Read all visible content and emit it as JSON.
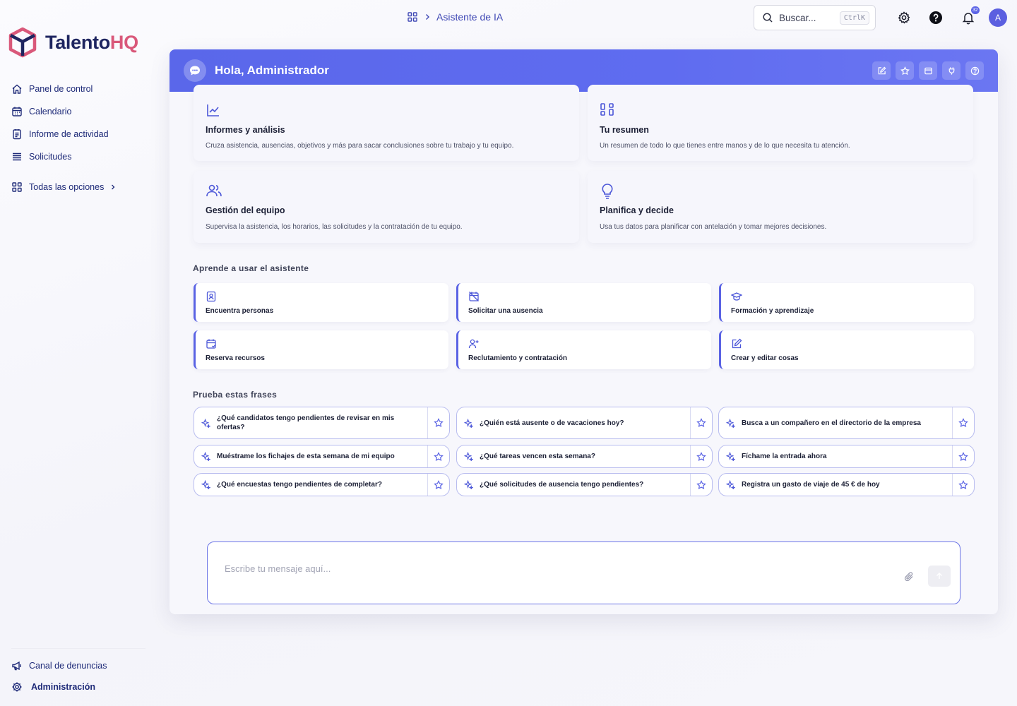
{
  "brand": {
    "name_main": "Talento",
    "name_accent": "HQ"
  },
  "sidebar": {
    "items": [
      {
        "label": "Panel de control",
        "icon": "home-icon"
      },
      {
        "label": "Calendario",
        "icon": "calendar-icon"
      },
      {
        "label": "Informe de actividad",
        "icon": "report-icon"
      },
      {
        "label": "Solicitudes",
        "icon": "list-icon"
      }
    ],
    "all_options": "Todas las opciones",
    "bottom": [
      {
        "label": "Canal de denuncias",
        "icon": "megaphone-icon"
      },
      {
        "label": "Administración",
        "icon": "gear-icon"
      }
    ]
  },
  "topbar": {
    "breadcrumb": "Asistente de IA",
    "search_label": "Buscar...",
    "search_shortcut": "CtrlK",
    "notifications_count": "32",
    "avatar_initial": "A"
  },
  "assistant": {
    "greeting": "Hola, Administrador",
    "features": [
      {
        "title": "Informes y análisis",
        "desc": "Cruza asistencia, ausencias, objetivos y más para sacar conclusiones sobre tu trabajo y tu equipo.",
        "icon": "line-chart-icon"
      },
      {
        "title": "Tu resumen",
        "desc": "Un resumen de todo lo que tienes entre manos y de lo que necesita tu atención.",
        "icon": "dashboard-icon"
      },
      {
        "title": "Gestión del equipo",
        "desc": "Supervisa la asistencia, los horarios, las solicitudes y la contratación de tu equipo.",
        "icon": "users-icon"
      },
      {
        "title": "Planifica y decide",
        "desc": "Usa tus datos para planificar con antelación y tomar mejores decisiones.",
        "icon": "lightbulb-icon"
      }
    ],
    "learn_title": "Aprende a usar el asistente",
    "learn": [
      {
        "label": "Encuentra personas",
        "icon": "contact-icon"
      },
      {
        "label": "Solicitar una ausencia",
        "icon": "calendar-off-icon"
      },
      {
        "label": "Formación y aprendizaje",
        "icon": "graduation-cap-icon"
      },
      {
        "label": "Reserva recursos",
        "icon": "calendar-check-icon"
      },
      {
        "label": "Reclutamiento y contratación",
        "icon": "user-plus-icon"
      },
      {
        "label": "Crear y editar cosas",
        "icon": "edit-icon"
      }
    ],
    "phrases_title": "Prueba estas frases",
    "phrases": [
      "¿Qué candidatos tengo pendientes de revisar en mis ofertas?",
      "¿Quién está ausente o de vacaciones hoy?",
      "Busca a un compañero en el directorio de la empresa",
      "Muéstrame los fichajes de esta semana de mi equipo",
      "¿Qué tareas vencen esta semana?",
      "Fíchame la entrada ahora",
      "¿Qué encuestas tengo pendientes de completar?",
      "¿Qué solicitudes de ausencia tengo pendientes?",
      "Registra un gasto de viaje de 45 € de hoy"
    ],
    "composer_placeholder": "Escribe tu mensaje aquí..."
  },
  "colors": {
    "accent": "#5a67ea",
    "brand_dark": "#1e2560",
    "brand_pink": "#d9587a"
  }
}
